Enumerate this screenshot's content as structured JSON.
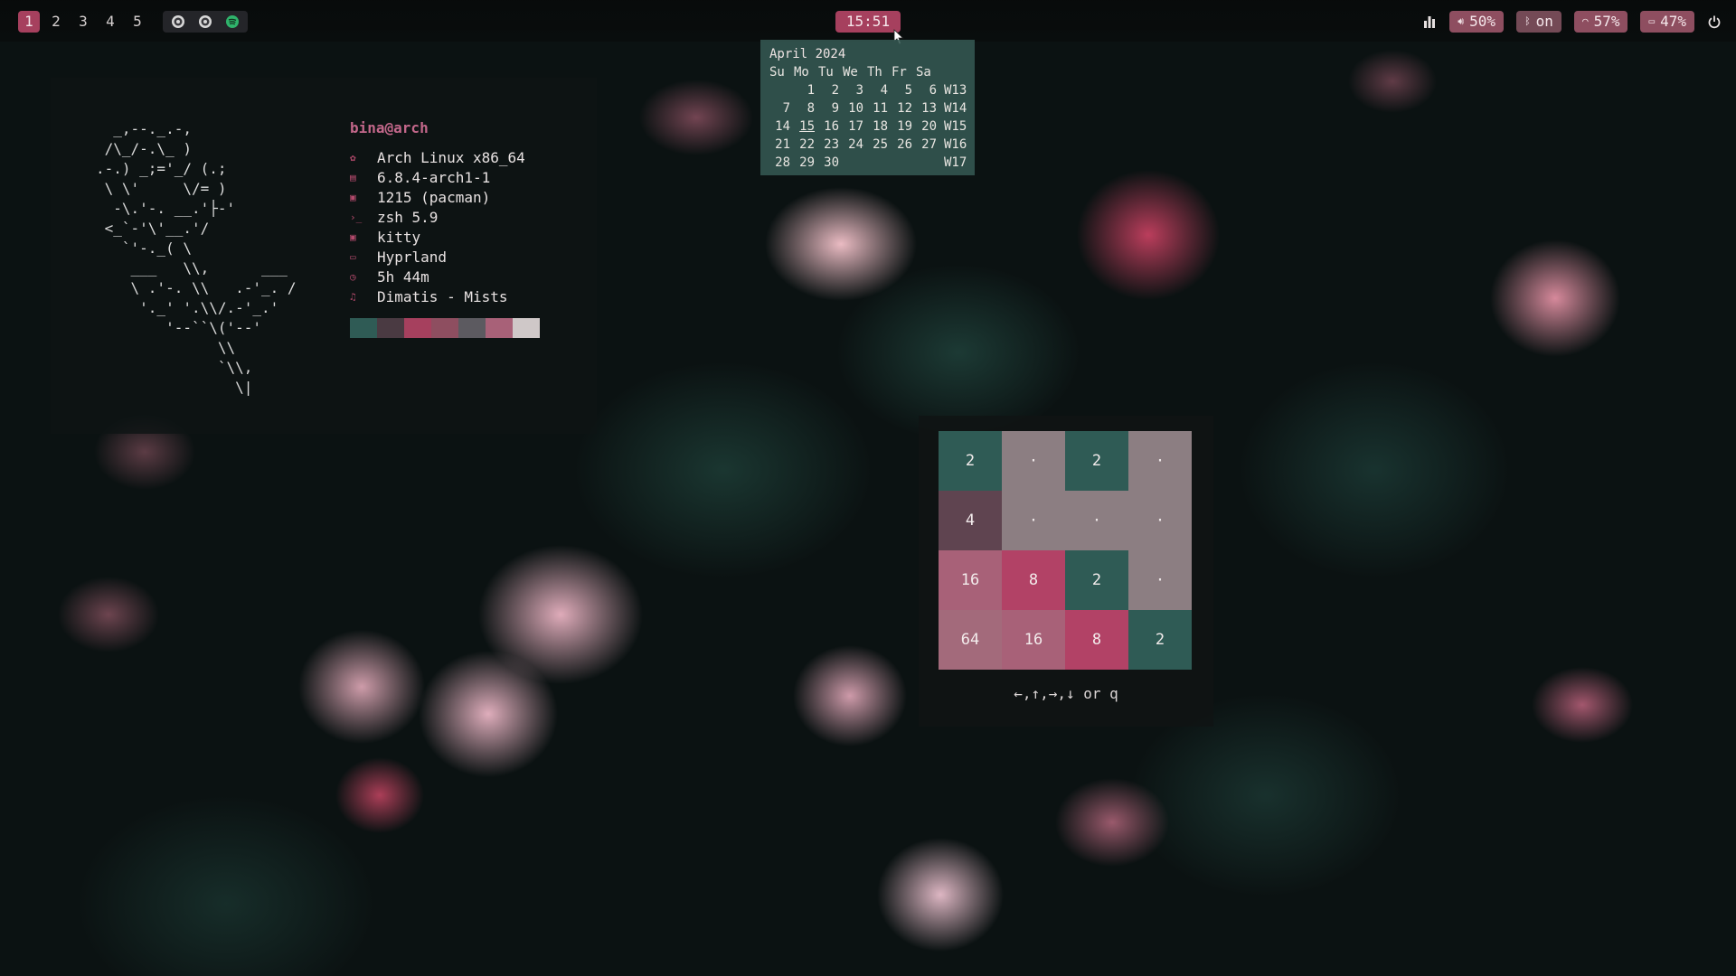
{
  "topbar": {
    "workspaces": [
      "1",
      "2",
      "3",
      "4",
      "5"
    ],
    "active_workspace": "1",
    "tray_icons": [
      "obs-icon",
      "obs-icon-2",
      "spotify-icon"
    ],
    "clock": "15:51",
    "status": {
      "volume": "50%",
      "bluetooth": "on",
      "wifi": "57%",
      "battery": "47%"
    },
    "accent_color": "#a6405e"
  },
  "calendar": {
    "title": "April 2024",
    "weekdays": [
      "Su",
      "Mo",
      "Tu",
      "We",
      "Th",
      "Fr",
      "Sa"
    ],
    "today": "15",
    "weeks": [
      {
        "days": [
          "",
          "1",
          "2",
          "3",
          "4",
          "5",
          "6"
        ],
        "week": "W13"
      },
      {
        "days": [
          "7",
          "8",
          "9",
          "10",
          "11",
          "12",
          "13"
        ],
        "week": "W14"
      },
      {
        "days": [
          "14",
          "15",
          "16",
          "17",
          "18",
          "19",
          "20"
        ],
        "week": "W15"
      },
      {
        "days": [
          "21",
          "22",
          "23",
          "24",
          "25",
          "26",
          "27"
        ],
        "week": "W16"
      },
      {
        "days": [
          "28",
          "29",
          "30",
          "",
          "",
          "",
          ""
        ],
        "week": "W17"
      }
    ]
  },
  "fetch": {
    "title": "bina@arch",
    "ascii": "  _,--._.-,\n /\\_/-.\\_ )\n.-.) _;='_/ (.;\n \\ \\'     \\/= )\n  -\\.'-. __.'├-'\n <_`-'\\'__.'/\n   `'-._( \\\n    ___   \\\\,      ___\n    \\ .'-. \\\\   .-'_. /\n     '._' '.\\\\/.-'_.'\n        '--``\\('--'\n              \\\\\n              `\\\\,\n                \\|",
    "rows": [
      {
        "icon": "os-icon",
        "text": "Arch Linux x86_64"
      },
      {
        "icon": "kernel-icon",
        "text": "6.8.4-arch1-1"
      },
      {
        "icon": "package-icon",
        "text": "1215 (pacman)"
      },
      {
        "icon": "shell-icon",
        "text": "zsh 5.9"
      },
      {
        "icon": "terminal-icon",
        "text": "kitty"
      },
      {
        "icon": "window-manager-icon",
        "text": "Hyprland"
      },
      {
        "icon": "clock-icon",
        "text": "5h 44m"
      },
      {
        "icon": "music-icon",
        "text": "Dimatis - Mists"
      }
    ],
    "palette": [
      "#2f5b55",
      "#4a3a42",
      "#a6405e",
      "#8e4e60",
      "#5c5a60",
      "#a86178",
      "#cfc8c8"
    ]
  },
  "game": {
    "board": [
      [
        "2",
        "·",
        "2",
        "·"
      ],
      [
        "4",
        "·",
        "·",
        "·"
      ],
      [
        "16",
        "8",
        "2",
        "·"
      ],
      [
        "64",
        "16",
        "8",
        "2"
      ]
    ],
    "hint": "←,↑,→,↓ or q"
  }
}
